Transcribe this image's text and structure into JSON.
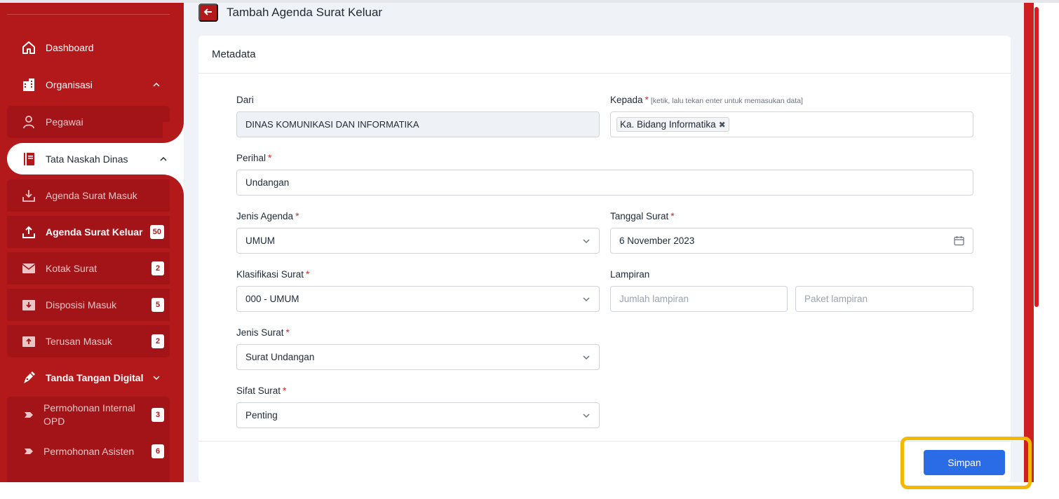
{
  "sidebar": {
    "items": [
      {
        "label": "Dashboard",
        "icon": "home-icon"
      },
      {
        "label": "Organisasi",
        "icon": "building-icon"
      },
      {
        "label": "Pegawai",
        "icon": "user-icon"
      },
      {
        "label": "Tata Naskah Dinas",
        "icon": "book-icon"
      },
      {
        "label": "Agenda Surat Masuk",
        "icon": "download-tray-icon"
      },
      {
        "label": "Agenda Surat Keluar",
        "icon": "upload-tray-icon",
        "badge": "50"
      },
      {
        "label": "Kotak Surat",
        "icon": "mail-icon",
        "badge": "2"
      },
      {
        "label": "Disposisi Masuk",
        "icon": "inbox-down-icon",
        "badge": "5"
      },
      {
        "label": "Terusan Masuk",
        "icon": "inbox-up-icon",
        "badge": "2"
      },
      {
        "label": "Tanda Tangan Digital",
        "icon": "pen-nib-icon"
      },
      {
        "label": "Permohonan Internal OPD",
        "icon": "tag-icon",
        "badge": "3"
      },
      {
        "label": "Permohonan Asisten",
        "icon": "tag-icon",
        "badge": "6"
      }
    ]
  },
  "page": {
    "title": "Tambah Agenda Surat Keluar",
    "card_title": "Metadata"
  },
  "form": {
    "dari": {
      "label": "Dari",
      "value": "DINAS KOMUNIKASI DAN INFORMATIKA"
    },
    "kepada": {
      "label": "Kepada",
      "required": "*",
      "hint": "[ketik, lalu tekan enter untuk memasukan data]",
      "tag": "Ka. Bidang Informatika",
      "tag_remove": "✖"
    },
    "perihal": {
      "label": "Perihal",
      "required": "*",
      "value": "Undangan"
    },
    "jenis_agenda": {
      "label": "Jenis Agenda",
      "required": "*",
      "value": "UMUM"
    },
    "tanggal_surat": {
      "label": "Tanggal Surat",
      "required": "*",
      "value": "6 November 2023"
    },
    "klasifikasi_surat": {
      "label": "Klasifikasi Surat",
      "required": "*",
      "value": "000 - UMUM"
    },
    "lampiran": {
      "label": "Lampiran",
      "jumlah_placeholder": "Jumlah lampiran",
      "paket_placeholder": "Paket lampiran"
    },
    "jenis_surat": {
      "label": "Jenis Surat",
      "required": "*",
      "value": "Surat Undangan"
    },
    "sifat_surat": {
      "label": "Sifat Surat",
      "required": "*",
      "value": "Penting"
    }
  },
  "actions": {
    "save_label": "Simpan"
  },
  "colors": {
    "brand_red": "#b3181b",
    "primary_blue": "#2a6be6",
    "highlight": "#f5b800"
  }
}
